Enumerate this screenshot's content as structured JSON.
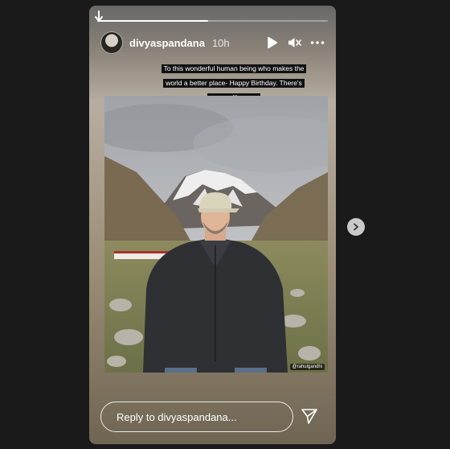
{
  "story": {
    "progress": 0.48,
    "username": "divyaspandana",
    "time_ago": "10h",
    "caption_lines": [
      "To this wonderful human being who makes the",
      "world a better place- Happy Birthday. There's",
      "no one like you."
    ],
    "photo_watermark": "@rahulgandhi",
    "reply_placeholder": "Reply to divyaspandana..."
  },
  "icons": {
    "play": "play-icon",
    "mute": "speaker-muted-icon",
    "more": "more-horizontal-icon",
    "send": "send-icon",
    "next": "chevron-right-icon"
  }
}
